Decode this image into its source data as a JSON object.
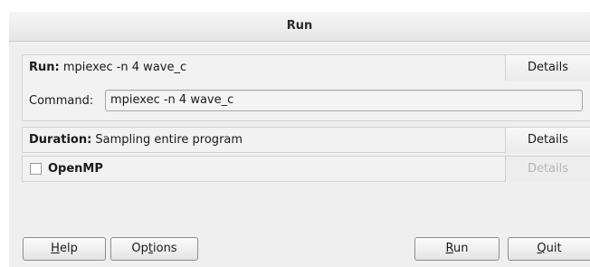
{
  "window": {
    "title": "Run"
  },
  "run_section": {
    "label_bold": "Run:",
    "label_value": " mpiexec -n 4 wave_c",
    "details_label": "Details",
    "command_label": "Command:",
    "command_value": "mpiexec -n 4 wave_c"
  },
  "duration_section": {
    "label_bold": "Duration:",
    "label_value": " Sampling entire program",
    "details_label": "Details"
  },
  "openmp_section": {
    "label_bold": "OpenMP",
    "checked": false,
    "details_label": "Details",
    "details_enabled": false
  },
  "buttons": {
    "help": {
      "mnemonic": "H",
      "rest": "elp"
    },
    "options": {
      "before": "Op",
      "mnemonic": "t",
      "rest": "ions"
    },
    "run": {
      "mnemonic": "R",
      "rest": "un"
    },
    "quit": {
      "mnemonic": "Q",
      "rest": "uit"
    }
  },
  "colors": {
    "background": "#efefef",
    "section_background": "#f2f2f2",
    "disabled_text": "#b6b6b6"
  }
}
